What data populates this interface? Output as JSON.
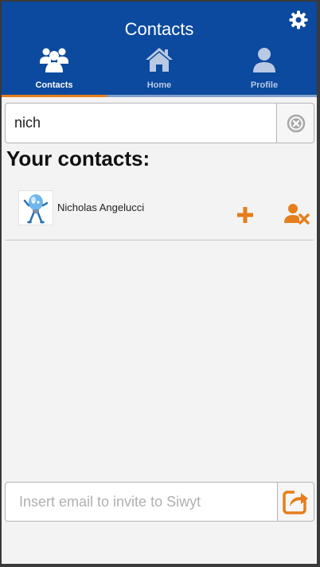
{
  "header": {
    "title": "Contacts",
    "settings_icon": "gear-icon"
  },
  "tabs": [
    {
      "label": "Contacts",
      "icon": "users-icon",
      "active": true
    },
    {
      "label": "Home",
      "icon": "home-icon",
      "active": false
    },
    {
      "label": "Profile",
      "icon": "user-icon",
      "active": false
    }
  ],
  "search": {
    "value": "nich",
    "clear_icon": "clear-circle-icon"
  },
  "contacts": {
    "heading": "Your contacts:",
    "items": [
      {
        "name": "Nicholas Angelucci",
        "avatar": "lightbulb-character-avatar"
      }
    ]
  },
  "invite": {
    "placeholder": "Insert email to invite to Siwyt",
    "value": "",
    "share_icon": "share-icon"
  },
  "colors": {
    "header_bg": "#0b4a9e",
    "accent": "#e67e1b",
    "tab_inactive": "#b9c9e4",
    "page_bg": "#f3f3f3"
  }
}
